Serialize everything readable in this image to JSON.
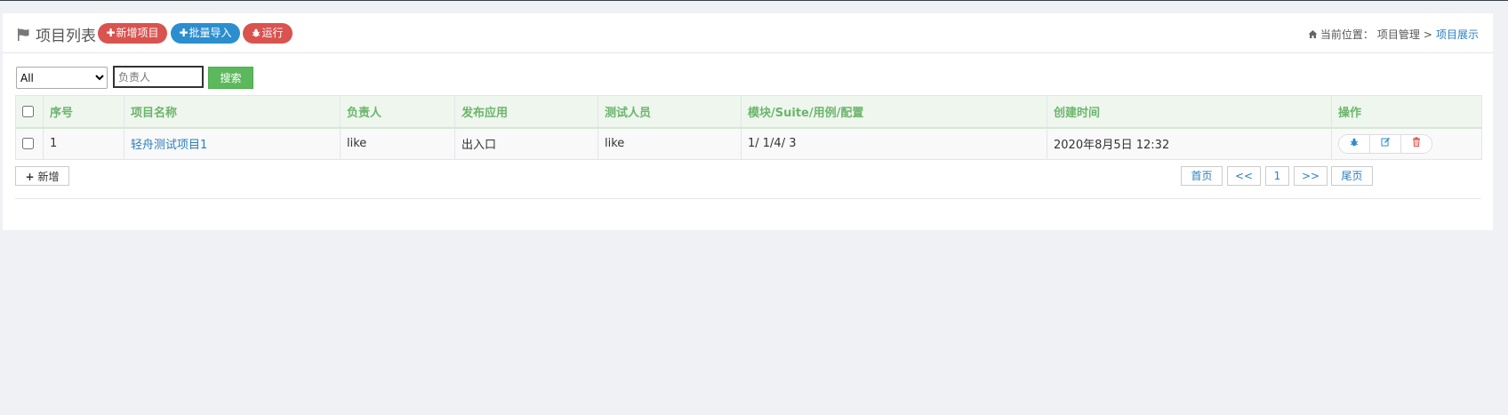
{
  "header": {
    "title": "项目列表",
    "buttons": {
      "new_project": "新增项目",
      "batch_import": "批量导入",
      "run": "运行"
    },
    "breadcrumb": {
      "prefix": "当前位置：",
      "parent": "项目管理",
      "separator": ">",
      "current": "项目展示"
    }
  },
  "filter": {
    "select_value": "All",
    "select_options": [
      "All"
    ],
    "owner_placeholder": "负责人",
    "search_label": "搜索"
  },
  "table": {
    "columns": [
      "序号",
      "项目名称",
      "负责人",
      "发布应用",
      "测试人员",
      "模块/Suite/用例/配置",
      "创建时间",
      "操作"
    ],
    "rows": [
      {
        "index": "1",
        "name": "轻舟测试项目1",
        "owner": "like",
        "app": "出入口",
        "tester": "like",
        "counts": "1/ 1/4/ 3",
        "created": "2020年8月5日 12:32"
      }
    ]
  },
  "footer": {
    "add_label": "新增",
    "pager": {
      "first": "首页",
      "prev": "<<",
      "page": "1",
      "next": ">>",
      "last": "尾页"
    }
  },
  "icons": {
    "title": "flag-icon",
    "breadcrumb": "home-icon",
    "run": "bug-icon",
    "ops": [
      "bug-icon",
      "edit-icon",
      "trash-icon"
    ]
  },
  "colors": {
    "red": "#d9534f",
    "blue": "#2b8ecf",
    "green": "#5cb85c",
    "header_green": "#6cb56c",
    "link": "#2a7fc0"
  }
}
